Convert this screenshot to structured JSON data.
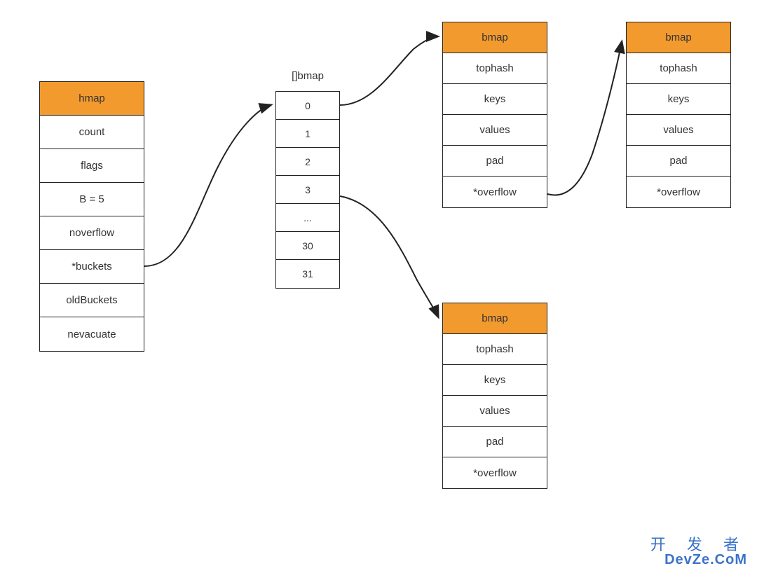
{
  "colors": {
    "header_bg": "#f29a2e",
    "border": "#222222",
    "watermark": "#3b73c8"
  },
  "hmap": {
    "title": "hmap",
    "fields": [
      "count",
      "flags",
      "B = 5",
      "noverflow",
      "*buckets",
      "oldBuckets",
      "nevacuate"
    ]
  },
  "bmap_array": {
    "label": "[]bmap",
    "cells": [
      "0",
      "1",
      "2",
      "3",
      "...",
      "30",
      "31"
    ]
  },
  "bmap_struct": {
    "title": "bmap",
    "fields": [
      "tophash",
      "keys",
      "values",
      "pad",
      "*overflow"
    ]
  },
  "watermark": {
    "line1": "开 发 者",
    "line2": "DevZe.CoM"
  }
}
